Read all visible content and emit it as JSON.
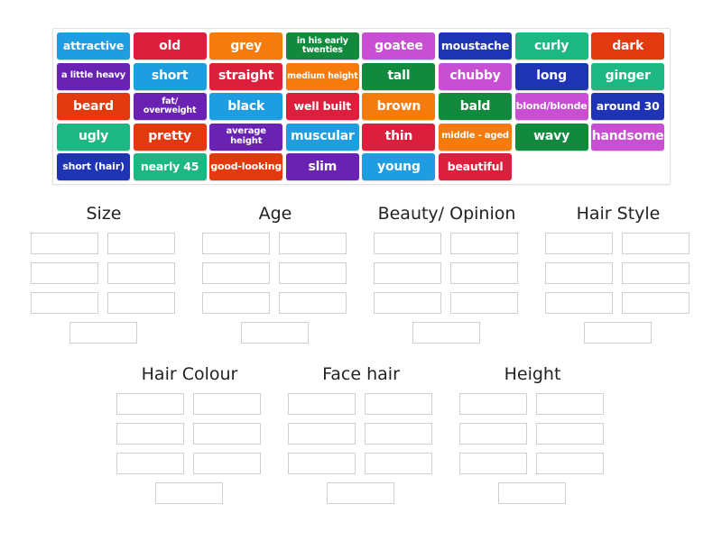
{
  "colors": {
    "blue": "#1e9ee0",
    "red": "#dc1f3c",
    "orange": "#f57b0c",
    "green": "#128a3d",
    "magenta": "#c84fd4",
    "navy": "#1f33b5",
    "teal": "#1db784",
    "redorange": "#e2390e",
    "purple": "#6a22b3"
  },
  "tiles": [
    {
      "label": "attractive",
      "color": "blue"
    },
    {
      "label": "old",
      "color": "red"
    },
    {
      "label": "grey",
      "color": "orange"
    },
    {
      "label": "in his early twenties",
      "color": "green"
    },
    {
      "label": "goatee",
      "color": "magenta"
    },
    {
      "label": "moustache",
      "color": "navy"
    },
    {
      "label": "curly",
      "color": "teal"
    },
    {
      "label": "dark",
      "color": "redorange"
    },
    {
      "label": "a little heavy",
      "color": "purple"
    },
    {
      "label": "short",
      "color": "blue"
    },
    {
      "label": "straight",
      "color": "red"
    },
    {
      "label": "medium height",
      "color": "orange"
    },
    {
      "label": "tall",
      "color": "green"
    },
    {
      "label": "chubby",
      "color": "magenta"
    },
    {
      "label": "long",
      "color": "navy"
    },
    {
      "label": "ginger",
      "color": "teal"
    },
    {
      "label": "beard",
      "color": "redorange"
    },
    {
      "label": "fat/ overweight",
      "color": "purple"
    },
    {
      "label": "black",
      "color": "blue"
    },
    {
      "label": "well built",
      "color": "red"
    },
    {
      "label": "brown",
      "color": "orange"
    },
    {
      "label": "bald",
      "color": "green"
    },
    {
      "label": "blond/blonde",
      "color": "magenta"
    },
    {
      "label": "around 30",
      "color": "navy"
    },
    {
      "label": "ugly",
      "color": "teal"
    },
    {
      "label": "pretty",
      "color": "redorange"
    },
    {
      "label": "average height",
      "color": "purple"
    },
    {
      "label": "muscular",
      "color": "blue"
    },
    {
      "label": "thin",
      "color": "red"
    },
    {
      "label": "middle - aged",
      "color": "orange"
    },
    {
      "label": "wavy",
      "color": "green"
    },
    {
      "label": "handsome",
      "color": "magenta"
    },
    {
      "label": "short (hair)",
      "color": "navy"
    },
    {
      "label": "nearly 45",
      "color": "teal"
    },
    {
      "label": "good-looking",
      "color": "redorange"
    },
    {
      "label": "slim",
      "color": "purple"
    },
    {
      "label": "young",
      "color": "blue"
    },
    {
      "label": "beautiful",
      "color": "red"
    }
  ],
  "groups": [
    {
      "title": "Size",
      "slots": 7
    },
    {
      "title": "Age",
      "slots": 7
    },
    {
      "title": "Beauty/ Opinion",
      "slots": 7
    },
    {
      "title": "Hair Style",
      "slots": 7
    },
    {
      "title": "Hair Colour",
      "slots": 7
    },
    {
      "title": "Face hair",
      "slots": 7
    },
    {
      "title": "Height",
      "slots": 7
    }
  ]
}
